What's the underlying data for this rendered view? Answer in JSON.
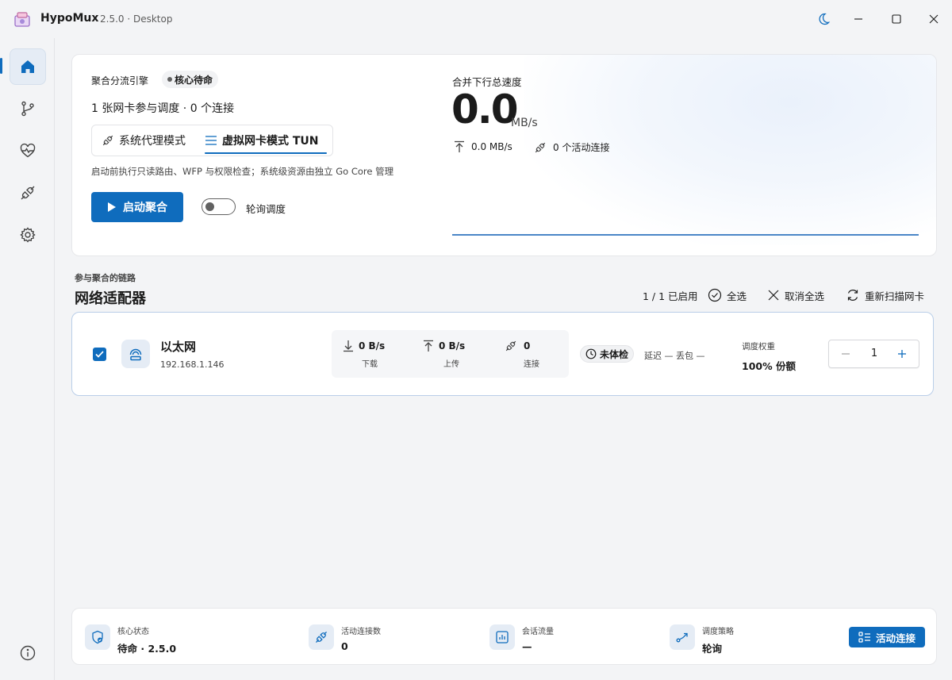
{
  "app": {
    "title": "HypoMux",
    "version": "2.5.0 · Desktop"
  },
  "hero": {
    "engine_label": "聚合分流引擎",
    "core_badge": "核心待命",
    "summary": "1 张网卡参与调度 · 0 个连接",
    "modes": [
      {
        "label": "系统代理模式",
        "active": false
      },
      {
        "label": "虚拟网卡模式 TUN",
        "active": true
      }
    ],
    "note": "启动前执行只读路由、WFP 与权限检查；系统级资源由独立 Go Core 管理",
    "start_label": "启动聚合",
    "poll_toggle_label": "轮询调度",
    "poll_toggle_on": false,
    "speed_label": "合并下行总速度",
    "speed_value": "0.0",
    "speed_unit": "MB/s",
    "upload_speed": "0.0 MB/s",
    "active_connections": "0 个活动连接"
  },
  "adapters_section": {
    "caption": "参与聚合的链路",
    "title": "网络适配器",
    "enabled_count": "1 / 1 已启用",
    "select_all": "全选",
    "deselect_all": "取消全选",
    "rescan": "重新扫描网卡"
  },
  "adapters": [
    {
      "checked": true,
      "name": "以太网",
      "ip": "192.168.1.146",
      "download": "0 B/s",
      "download_label": "下载",
      "upload": "0 B/s",
      "upload_label": "上传",
      "connections": "0",
      "connections_label": "连接",
      "probe_status": "未体检",
      "latency": "延迟 —  丢包 —",
      "weight_label": "调度权重",
      "weight_share": "100% 份额",
      "weight_value": "1"
    }
  ],
  "footer": {
    "items": [
      {
        "label": "核心状态",
        "value": "待命 · 2.5.0"
      },
      {
        "label": "活动连接数",
        "value": "0"
      },
      {
        "label": "会话流量",
        "value": "—"
      },
      {
        "label": "调度策略",
        "value": "轮询"
      }
    ],
    "active_connections_button": "活动连接"
  },
  "colors": {
    "accent": "#0f6cbd",
    "background": "#f3f4f6"
  }
}
